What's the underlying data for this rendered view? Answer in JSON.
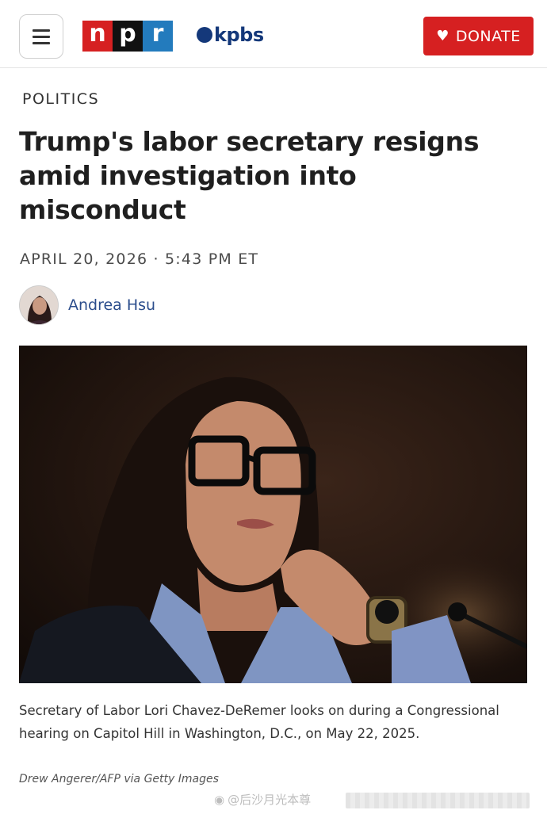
{
  "header": {
    "menu_icon": "hamburger-icon",
    "npr_letters": [
      "n",
      "p",
      "r"
    ],
    "npr_colors": [
      "#d62021",
      "#111111",
      "#237bbd"
    ],
    "kpbs_label": "kpbs",
    "kpbs_color": "#14387a",
    "donate_label": "DONATE",
    "donate_icon": "heart-icon",
    "donate_color": "#d62021"
  },
  "article": {
    "section": "POLITICS",
    "headline": "Trump's labor secretary resigns amid investigation into misconduct",
    "dateline": "APRIL 20, 2026 · 5:43 PM ET",
    "author": "Andrea Hsu",
    "caption": "Secretary of Labor Lori Chavez-DeRemer looks on during a Congressional hearing on Capitol Hill in Washington, D.C., on May 22, 2025.",
    "credit": "Drew Angerer/AFP via Getty Images"
  },
  "watermark": {
    "text": "@后沙月光本尊",
    "icon": "weibo-icon"
  }
}
